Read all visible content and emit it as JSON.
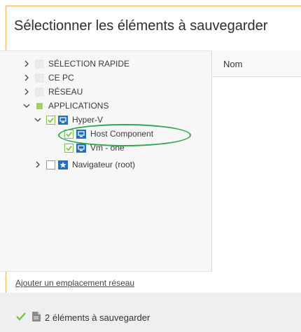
{
  "dialog": {
    "title": "Sélectionner les éléments à sauvegarder"
  },
  "tree": {
    "items": [
      {
        "label": "SÉLECTION RAPIDE"
      },
      {
        "label": "CE PC"
      },
      {
        "label": "RÉSEAU"
      },
      {
        "label": "APPLICATIONS"
      },
      {
        "label": "Hyper-V"
      },
      {
        "label": "Host Component"
      },
      {
        "label": "Vm - one"
      },
      {
        "label": "Navigateur (root)"
      }
    ]
  },
  "list": {
    "column_name": "Nom"
  },
  "actions": {
    "add_network_location": "Ajouter un emplacement réseau"
  },
  "footer": {
    "summary": "2 éléments à sauvegarder"
  },
  "colors": {
    "check_green": "#7fc241",
    "vm_blue": "#1f6fc5",
    "annotation_green": "#2ea84a"
  }
}
